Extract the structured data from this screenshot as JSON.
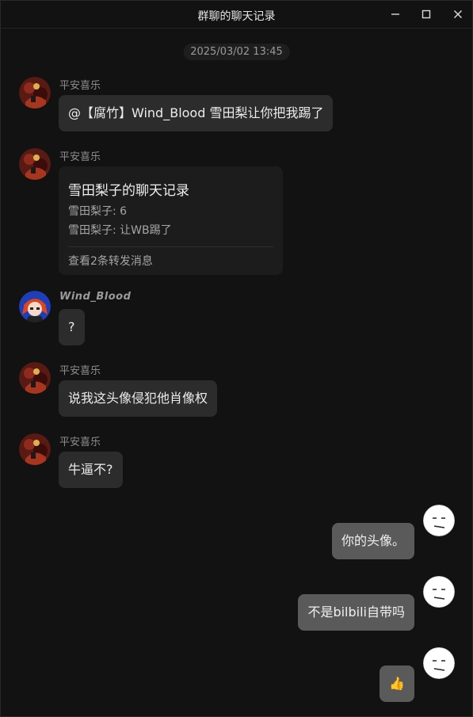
{
  "window": {
    "title": "群聊的聊天记录",
    "minimize_icon": "minimize-icon",
    "maximize_icon": "maximize-icon",
    "close_icon": "close-icon"
  },
  "timestamp": "2025/03/02 13:45",
  "messages": [
    {
      "sender": "平安喜乐",
      "text": "@【腐竹】Wind_Blood 雪田梨让你把我踢了"
    },
    {
      "sender": "平安喜乐",
      "forward": {
        "title": "雪田梨子的聊天记录",
        "lines": [
          "雪田梨子: 6",
          "雪田梨子: 让WB踢了"
        ],
        "footer": "查看2条转发消息"
      }
    },
    {
      "sender": "Wind_Blood",
      "text": "?"
    },
    {
      "sender": "平安喜乐",
      "text": "说我这头像侵犯他肖像权"
    },
    {
      "sender": "平安喜乐",
      "text": "牛逼不?"
    },
    {
      "sender": "",
      "text": "你的头像。",
      "side": "right"
    },
    {
      "sender": "",
      "text": "不是bilbili自带吗",
      "side": "right"
    },
    {
      "sender": "",
      "text": "👍",
      "side": "right"
    }
  ],
  "colors": {
    "background": "#121212",
    "left_bubble": "#2c2c2c",
    "right_bubble": "#5a5a5a",
    "sender_text": "#8d8d8d"
  }
}
